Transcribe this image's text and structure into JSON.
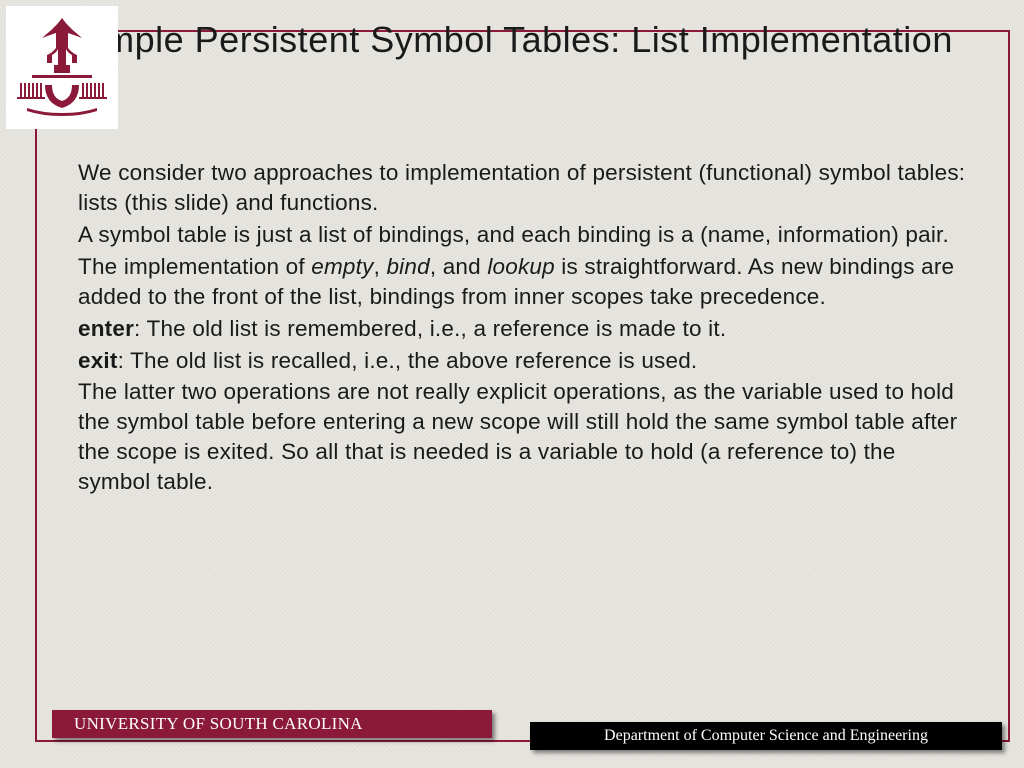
{
  "title": "Simple Persistent Symbol Tables: List Implementation",
  "paragraphs": {
    "p1": "We consider two approaches to implementation of persistent (functional) symbol tables: lists (this slide) and functions.",
    "p2": "A symbol table is just a list of bindings, and each binding is a (name, information) pair.",
    "p3a": "The implementation of ",
    "p3_empty": "empty",
    "p3b": ", ",
    "p3_bind": "bind",
    "p3c": ", and ",
    "p3_lookup": "lookup",
    "p3d": " is straightforward.  As new bindings are added to the front of the list, bindings from inner scopes take precedence.",
    "p4_bold": "enter",
    "p4": ": The old list is remembered, i.e., a reference is made to it.",
    "p5_bold": "exit",
    "p5": ": The old list is recalled, i.e., the above reference is used.",
    "p6": "The latter two operations are not really explicit operations, as the variable used to hold the symbol table before entering a new scope will still hold the same symbol table after the scope is exited. So all that is needed is a variable to hold (a reference to) the symbol table."
  },
  "footer": {
    "university": "UNIVERSITY OF SOUTH CAROLINA",
    "department": "Department of Computer Science and Engineering"
  }
}
